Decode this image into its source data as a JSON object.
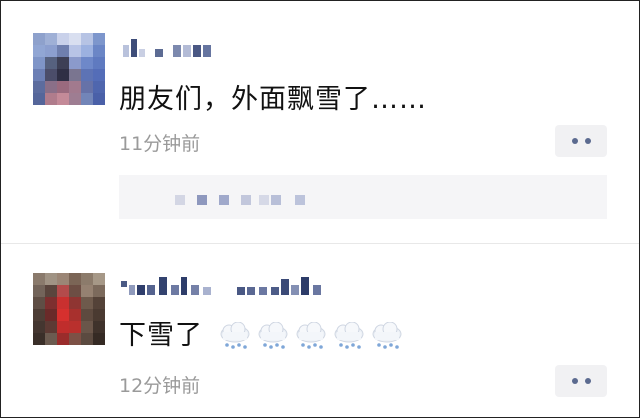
{
  "posts": [
    {
      "text": "朋友们，外面飘雪了……",
      "time": "11分钟前"
    },
    {
      "text": "下雪了",
      "time": "12分钟前",
      "emojis": [
        "cloud-snow-icon",
        "cloud-snow-icon",
        "cloud-snow-icon",
        "cloud-snow-icon",
        "cloud-snow-icon"
      ]
    }
  ],
  "colors": {
    "time": "#9a9a9a",
    "dots": "#5b6a8f",
    "name_blur": "#5b6a8f"
  }
}
